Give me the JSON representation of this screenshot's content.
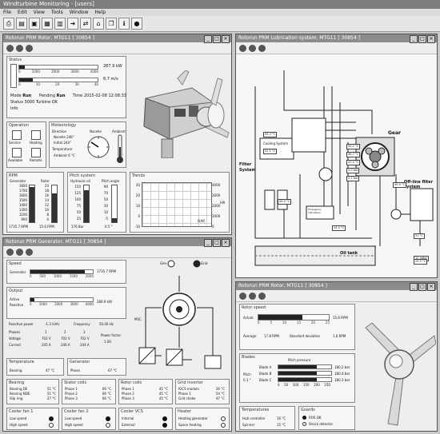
{
  "app_title": "Windturbine Monitoring - [users]",
  "menu": [
    "File",
    "Edit",
    "View",
    "Tools",
    "Window",
    "Help"
  ],
  "toolbar_icons": [
    "printer-icon",
    "open-icon",
    "save-icon",
    "grid-icon",
    "chart-icon",
    "arrow-icon",
    "link-icon",
    "home-icon",
    "window-icon",
    "info-icon",
    "globe-icon"
  ],
  "windows": {
    "rotor_top": {
      "title": "Rotorun PRM Rotor, MTG11 [ 30854 ]",
      "status": {
        "label": "Status",
        "power_value": "287.9 kW",
        "wind_value": "6.7 m/s",
        "power_ticks": [
          "0",
          "1000",
          "2000",
          "3000",
          "4000"
        ],
        "wind_ticks": [
          "0",
          "10",
          "20",
          "30",
          "40"
        ],
        "power_fraction": 0.07,
        "wind_fraction": 0.17,
        "mode_label": "Mode",
        "mode_value": "Run",
        "pending_label": "Pending",
        "pending_value": "Run",
        "time_label": "Time",
        "time_value": "2015-02-08 12:08:33",
        "status_label": "Status",
        "status_value": "3000 Turbine OK",
        "info_label": "Info"
      },
      "operation": {
        "label": "Operation",
        "service": "Service",
        "heating": "Heating",
        "available": "Available",
        "remote": "Remote"
      },
      "meteorology": {
        "label": "Meteorology",
        "direction": "Direction",
        "nacelle": "Nacelle",
        "nacelle_value": "246°",
        "initial": "Initial",
        "initial_value": "244°",
        "temperature": "Temperature",
        "ambient": "Ambient",
        "ambient_value": "6 °C",
        "nacelle_dial": "Nacelle",
        "ambient_dial": "Ambient"
      },
      "rpm": {
        "label": "RPM",
        "generator": "Generator",
        "rotor": "Rotor",
        "gen_ticks": [
          "1800",
          "1700",
          "1600",
          "1500",
          "1400",
          "1300",
          "1100",
          "900"
        ],
        "rotor_ticks": [
          "20",
          "18",
          "16",
          "14",
          "12",
          "10",
          "8",
          "0"
        ],
        "gen_value": "1735.7 RPM",
        "rotor_value": "15.6 RPM"
      },
      "pitch": {
        "label": "Pitch system",
        "hydraulic": "Hydraulic oil",
        "angle": "Pitch angle",
        "hyd_ticks": [
          "150",
          "125",
          "100",
          "75",
          "50",
          "25"
        ],
        "angle_ticks": [
          "90",
          "70",
          "50",
          "30",
          "10",
          "-5"
        ],
        "hyd_value": "176 Bar",
        "angle_value": "0.5 °"
      },
      "trend": {
        "label": "Trends",
        "left_ticks": [
          "30",
          "20",
          "10",
          "0",
          "-10"
        ],
        "right_ticks": [
          "4000",
          "3000",
          "2000",
          "1000",
          "0"
        ],
        "unit_right": "kW",
        "legend": "[kW]"
      }
    },
    "lube": {
      "title": "Rotorun PRM Lubrication system, MTG11 [ 30854 ]",
      "gear": "Gear",
      "cooling": "Cooling System",
      "filter": "Filter System",
      "offline": "Off-line filter system",
      "oil_tank": "Oil tank",
      "emergency": "Emergency lubrication",
      "tags": [
        "55.3 °C",
        "52.1 °C",
        "49.9 °C",
        "50.2 °C",
        "48.7 °C",
        "47.5 °C",
        "2.0 bar",
        "2.1 bar",
        "40.5 °C",
        "0.1 bar",
        "44.5 °C",
        "51 °C",
        "12 mBar",
        "29.9 °C"
      ]
    },
    "generator": {
      "title": "Rotorun PRM Generator, MTG11 [ 30854 ]",
      "speed": {
        "label": "Speed",
        "name": "Generator",
        "value": "1735.7 RPM",
        "ticks": [
          "0",
          "500",
          "1000",
          "1500",
          "2000"
        ],
        "fraction": 0.87
      },
      "output": {
        "label": "Output",
        "active": "Active",
        "reactive": "Reactive",
        "value": "286.9 kW",
        "ticks": [
          "0",
          "1000",
          "2000",
          "3000",
          "4000"
        ],
        "fraction": 0.07
      },
      "electrical": {
        "reactive_power": "Reactive power",
        "reactive_power_value": "-1.3 kVAr",
        "frequency": "Frequency",
        "frequency_value": "50.00 Hz",
        "phase": "Phases",
        "cols": [
          "1",
          "2",
          "3"
        ],
        "voltage": "Voltage",
        "voltage_values": [
          "702 V",
          "702 V",
          "702 V"
        ],
        "current": "Current",
        "current_values": [
          "245 A",
          "246 A",
          "244 A"
        ],
        "power_factor": "Power factor",
        "power_factor_value": "1.00"
      },
      "temperature": {
        "label": "Temperature",
        "name": "Bearing",
        "value": "47 °C"
      },
      "generator_temp": {
        "label": "Generator",
        "name": "Phase",
        "value": "67 °C"
      },
      "bearing": {
        "label": "Bearing",
        "rows": [
          [
            "Bearing DE",
            "51 °C"
          ],
          [
            "Bearing NDE",
            "51 °C"
          ],
          [
            "Slip ring",
            "27 °C"
          ]
        ]
      },
      "stator": {
        "label": "Stator coils",
        "rows": [
          [
            "Phase 1",
            "66 °C"
          ],
          [
            "Phase 2",
            "66 °C"
          ],
          [
            "Phase 3",
            "66 °C"
          ]
        ]
      },
      "rotor_coils": {
        "label": "Rotor coils",
        "rows": [
          [
            "Phase 1",
            "45 °C"
          ],
          [
            "Phase 2",
            "45 °C"
          ],
          [
            "Phase 3",
            "45 °C"
          ]
        ]
      },
      "grid": {
        "label": "Grid inverter",
        "rows": [
          [
            "IGCS module",
            "26 °C"
          ],
          [
            "Phase 1",
            "54 °C"
          ],
          [
            "Grid choke",
            "47 °C"
          ]
        ]
      },
      "cooler_fan1": {
        "label": "Cooler fan 1",
        "a": "Low speed",
        "b": "High speed"
      },
      "cooler_fan2": {
        "label": "Cooler fan 2",
        "a": "Low speed",
        "b": "High speed"
      },
      "cooler_ctrl": {
        "label": "Cooler VCS",
        "a": "Internal",
        "b": "External"
      },
      "heater": {
        "label": "Heater",
        "a": "Heating generator",
        "b": "Space heating"
      },
      "legend_gen": "Gen",
      "legend_grid": "Grid",
      "inv_label": "MSC"
    },
    "rotor_bottom": {
      "title": "Rotorun PRM Rotor, MTG11 [ 30854 ]",
      "rotor_speed": {
        "label": "Rotor speed",
        "actual": "Actual",
        "value": "15.6 RPM",
        "ticks": [
          "0",
          "5",
          "10",
          "15",
          "20",
          "25"
        ],
        "fraction": 0.62,
        "average": "Average",
        "average_value": "17.8 RPM",
        "std": "Standard deviation",
        "std_value": "1.6 RPM"
      },
      "blades": {
        "label": "Blades",
        "pitch": "Pitch",
        "pitch_value": "0.1 °",
        "pressure": "Pitch pressure",
        "rows": [
          [
            "Blade A",
            "180.2 bar",
            0.72
          ],
          [
            "Blade B",
            "180.4 bar",
            0.72
          ],
          [
            "Blade C",
            "180.3 bar",
            0.72
          ]
        ],
        "ticks": [
          "0",
          "50",
          "100",
          "150",
          "200",
          "250"
        ]
      },
      "temps": {
        "label": "Temperatures",
        "hub": "Hub controller",
        "hub_value": "16 °C",
        "spinner": "Spinner",
        "spinner_value": "15 °C"
      },
      "guards": {
        "label": "Guards",
        "a": "ROS OK",
        "b": "Shock detector"
      }
    }
  }
}
